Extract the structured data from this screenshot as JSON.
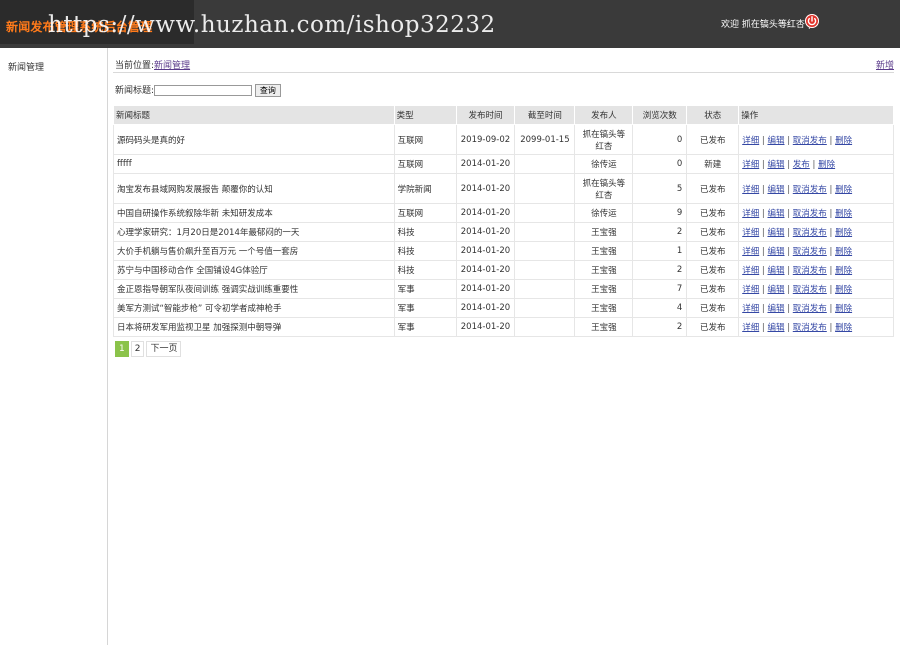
{
  "header": {
    "app_title": "新闻发布管理系统后台管理",
    "watermark": "https://www.huzhan.com/ishop32232",
    "welcome": "欢迎 抓在镐头等红杏 |",
    "logout_icon": "power-icon"
  },
  "sidebar": {
    "items": [
      {
        "label": "新闻管理"
      }
    ]
  },
  "main": {
    "crumb_prefix": "当前位置:",
    "crumb_link": "新闻管理",
    "add_label": "新增",
    "search": {
      "label": "新闻标题:",
      "value": "",
      "button": "查询"
    },
    "columns": [
      "新闻标题",
      "类型",
      "发布时间",
      "截至时间",
      "发布人",
      "浏览次数",
      "状态",
      "操作"
    ],
    "rows": [
      {
        "title": "源码码头是真的好",
        "type": "互联网",
        "publish": "2019-09-02",
        "deadline": "2099-01-15",
        "author": "抓在镐头等红杏",
        "views": "0",
        "status": "已发布",
        "status_kind": "on",
        "ops": [
          "详细",
          "编辑",
          "取消发布",
          "删除"
        ]
      },
      {
        "title": "fffff",
        "type": "互联网",
        "publish": "2014-01-20",
        "deadline": "",
        "author": "徐传运",
        "views": "0",
        "status": "新建",
        "status_kind": "new",
        "ops": [
          "详细",
          "编辑",
          "发布",
          "删除"
        ]
      },
      {
        "title": "淘宝发布县域网购发展报告 颠覆你的认知",
        "type": "学院新闻",
        "publish": "2014-01-20",
        "deadline": "",
        "author": "抓在镐头等红杏",
        "views": "5",
        "status": "已发布",
        "status_kind": "on",
        "ops": [
          "详细",
          "编辑",
          "取消发布",
          "删除"
        ]
      },
      {
        "title": "中国自研操作系统叙除华新 未知研发成本",
        "type": "互联网",
        "publish": "2014-01-20",
        "deadline": "",
        "author": "徐传运",
        "views": "9",
        "status": "已发布",
        "status_kind": "on",
        "ops": [
          "详细",
          "编辑",
          "取消发布",
          "删除"
        ]
      },
      {
        "title": "心理学家研究：1月20日是2014年最郁闷的一天",
        "type": "科技",
        "publish": "2014-01-20",
        "deadline": "",
        "author": "王宝强",
        "views": "2",
        "status": "已发布",
        "status_kind": "on",
        "ops": [
          "详细",
          "编辑",
          "取消发布",
          "删除"
        ]
      },
      {
        "title": "大价手机躺与售价飙升至百万元 一个号值一套房",
        "type": "科技",
        "publish": "2014-01-20",
        "deadline": "",
        "author": "王宝强",
        "views": "1",
        "status": "已发布",
        "status_kind": "on",
        "ops": [
          "详细",
          "编辑",
          "取消发布",
          "删除"
        ]
      },
      {
        "title": "苏宁与中国移动合作 全国铺设4G体验厅",
        "type": "科技",
        "publish": "2014-01-20",
        "deadline": "",
        "author": "王宝强",
        "views": "2",
        "status": "已发布",
        "status_kind": "on",
        "ops": [
          "详细",
          "编辑",
          "取消发布",
          "删除"
        ]
      },
      {
        "title": "金正恩指导朝军队夜间训练 强调实战训练重要性",
        "type": "军事",
        "publish": "2014-01-20",
        "deadline": "",
        "author": "王宝强",
        "views": "7",
        "status": "已发布",
        "status_kind": "on",
        "ops": [
          "详细",
          "编辑",
          "取消发布",
          "删除"
        ]
      },
      {
        "title": "美军方测试“智能步枪” 可令初学者成神枪手",
        "type": "军事",
        "publish": "2014-01-20",
        "deadline": "",
        "author": "王宝强",
        "views": "4",
        "status": "已发布",
        "status_kind": "on",
        "ops": [
          "详细",
          "编辑",
          "取消发布",
          "删除"
        ]
      },
      {
        "title": "日本将研发军用监视卫星 加强探测中朝导弹",
        "type": "军事",
        "publish": "2014-01-20",
        "deadline": "",
        "author": "王宝强",
        "views": "2",
        "status": "已发布",
        "status_kind": "on",
        "ops": [
          "详细",
          "编辑",
          "取消发布",
          "删除"
        ]
      }
    ],
    "pager": {
      "pages": [
        "1",
        "2"
      ],
      "current": "1",
      "next": "下一页"
    }
  }
}
